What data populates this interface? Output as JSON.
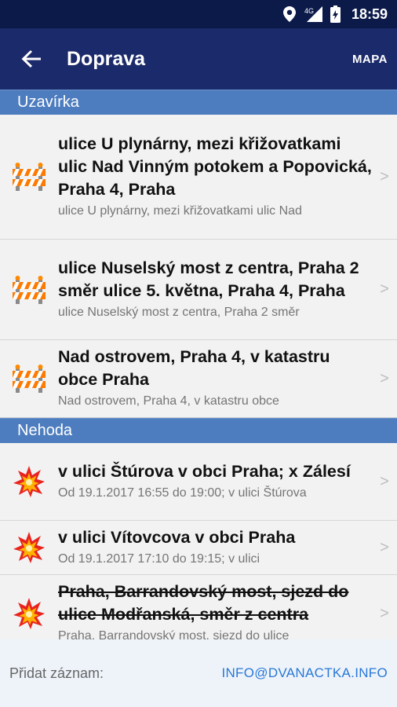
{
  "status_bar": {
    "time": "18:59",
    "network": "4G"
  },
  "app_bar": {
    "back_icon": "arrow-back-icon",
    "title": "Doprava",
    "action": "MAPA"
  },
  "sections": [
    {
      "header": "Uzavírka",
      "icon": "roadblock-icon",
      "items": [
        {
          "title": "ulice U plynárny, mezi křižovatkami ulic Nad Vinným potokem a Popovická, Praha 4, Praha",
          "subtitle": "ulice U plynárny, mezi křižovatkami ulic Nad"
        },
        {
          "title": "ulice Nuselský most z centra, Praha 2 směr ulice 5. května, Praha 4, Praha",
          "subtitle": "ulice Nuselský most z centra, Praha 2 směr"
        },
        {
          "title": "Nad ostrovem, Praha 4, v katastru obce Praha",
          "subtitle": "Nad ostrovem, Praha 4, v katastru obce"
        }
      ]
    },
    {
      "header": "Nehoda",
      "icon": "accident-explosion-icon",
      "items": [
        {
          "title": "v ulici Štúrova v obci Praha; x Zálesí",
          "subtitle": "Od 19.1.2017 16:55 do 19:00; v ulici Štúrova"
        },
        {
          "title": "v ulici Vítovcova v obci Praha",
          "subtitle": "Od 19.1.2017 17:10 do 19:15; v ulici"
        },
        {
          "title": "Praha, Barrandovský most, sjezd do ulice Modřanská, směr z centra",
          "subtitle": "Praha, Barrandovský most, sjezd do ulice",
          "struck": true
        }
      ]
    }
  ],
  "chevron": ">",
  "footer": {
    "label": "Přidat záznam:",
    "email": "INFO@DVANACTKA.INFO"
  },
  "colors": {
    "app_bar": "#1b2a6a",
    "section_header": "#4d7dbf",
    "link": "#2878d6"
  }
}
